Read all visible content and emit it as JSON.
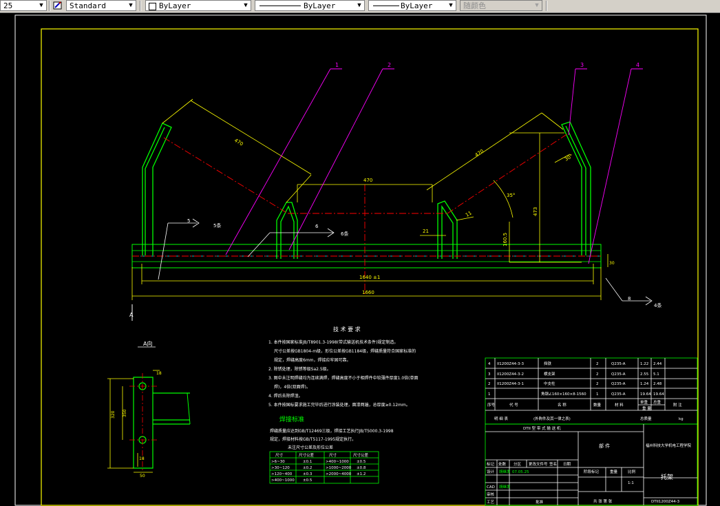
{
  "toolbar": {
    "linetype_scale": "25",
    "text_style": "Standard",
    "layer_control": "ByLayer",
    "linetype": "ByLayer",
    "lineweight": "ByLayer",
    "plot_style": "随颜色",
    "icons": [
      "text-style-icon",
      "color-swatch-icon"
    ]
  },
  "colors": {
    "background": "#000000",
    "border_white": "#ffffff",
    "frame": "#ffff00",
    "part": "#00ff00",
    "leader": "#ff00ff",
    "center": "#ff0000",
    "cyan": "#00ffff"
  },
  "drawing": {
    "balloons": [
      "1",
      "2",
      "3",
      "4"
    ],
    "dims": {
      "overall_length": "1660",
      "inner_span": "1640 ±1",
      "mid_roll": "470",
      "side_roll_left": "470",
      "side_roll_right": "470",
      "height": "473",
      "angle": "35°",
      "dim_160": "160.5",
      "dim_21": "21",
      "dim_11": "11",
      "dim_30": "30°",
      "right_end": "30"
    },
    "weld_marks": [
      {
        "num": "5",
        "label": "5条"
      },
      {
        "num": "6",
        "label": "6条"
      },
      {
        "num": "8",
        "label": "4条"
      }
    ],
    "section_mark": "A"
  },
  "detail_view": {
    "title": "A向",
    "dims": [
      "18",
      "320",
      "350",
      "18",
      "50"
    ]
  },
  "tech_requirements": {
    "title": "技 术 要 求",
    "items": [
      "1. 本件按国家标准JB/T8901.3-1998(带式输送机技术条件)规定制造。",
      "尺寸公差按GB1804-m级，形位公差按GB1184级，焊缝质量符合国家标准的",
      "规定，焊缝高度6mm，焊接应牢固可靠。",
      "2. 除锈处理，除锈等级Sa2.5级。",
      "3. 图中未注明焊缝均为连续满焊，焊缝高度不小于相焊件中较薄件厚度1.0倍(单面",
      "焊)，4倍(双面焊)。",
      "4. 焊后去除焊渣。",
      "5. 本件按国标要求施工完毕后进行涂装处理，面漆两遍，总厚度≥0.12mm。"
    ],
    "weld_title": "焊接标准",
    "weld_items": [
      "焊缝质量应达到GB/T12469三级，焊接工艺执行JB/T5000.3-1998",
      "规定，焊接材料按GB/T5117-1995规定执行。"
    ],
    "tolerance_title": "未注尺寸公差及形位公差",
    "tolerance_headers": [
      "尺寸",
      "尺寸公差",
      "尺寸",
      "尺寸公差"
    ],
    "tolerance_rows": [
      [
        ">6~30",
        "±0.1",
        ">400~1000",
        "±0.5"
      ],
      [
        ">30~120",
        "±0.2",
        ">1000~2000",
        "±0.8"
      ],
      [
        ">120~400",
        "±0.3",
        ">2000~4000",
        "±1.2"
      ],
      [
        ">400~1000",
        "±0.5",
        "",
        ""
      ]
    ]
  },
  "title_block": {
    "bom": [
      {
        "no": "4",
        "code": "II1200Z44-3-3",
        "name": "挡铁",
        "qty": "2",
        "material": "Q235-A",
        "unit": "1.22",
        "total": "2.44"
      },
      {
        "no": "3",
        "code": "II1200Z44-3-2",
        "name": "横支架",
        "qty": "2",
        "material": "Q235-A",
        "unit": "2.55",
        "total": "5.1"
      },
      {
        "no": "2",
        "code": "II1200Z44-3-1",
        "name": "中支柱",
        "qty": "2",
        "material": "Q235-A",
        "unit": "1.24",
        "total": "2.48"
      },
      {
        "no": "1",
        "code": "",
        "name": "角钢∠160×160×8-1560",
        "qty": "1",
        "material": "Q235-A",
        "unit": "19.64",
        "total": "19.64"
      }
    ],
    "bom_headers": [
      "序号",
      "代 号",
      "名 称",
      "数量",
      "材 料",
      "单重",
      "总重",
      "附 注"
    ],
    "bom_weight_label": "重 量",
    "bom_weight_unit": "kg",
    "list_label_1": "明 细 表",
    "list_label_2": "(外购件及其一律之表)",
    "total_weight_label": "总质量",
    "total_weight_unit": "kg",
    "assembly_title": "DTII 型 带 式 输 送 机",
    "part_label": "部 件",
    "school": "福州科技大学机电工程学院",
    "drawing_name": "托架",
    "drawing_no": "DTII1200Z44-3",
    "scale_label": "比例",
    "scale": "1:1",
    "stage_label": "阶段标记",
    "weight_label": "重量",
    "sheet_label": "共 张 第 张",
    "revision_headers": [
      "标记",
      "处数",
      "分区",
      "更改文件号",
      "签名",
      "日期"
    ],
    "roles": [
      "设计",
      "CAD",
      "审核",
      "工艺"
    ],
    "designer": "胡继发",
    "date": "07.05.25",
    "cad": "胡继发",
    "approve_label": "批准"
  }
}
